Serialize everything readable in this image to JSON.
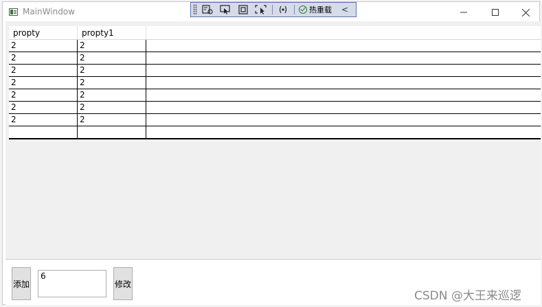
{
  "window": {
    "title": "MainWindow"
  },
  "debug_toolbar": {
    "hot_reload_label": "热重载",
    "collapse_glyph": "<"
  },
  "grid": {
    "columns": [
      "propty",
      "propty1"
    ],
    "rows": [
      [
        "2",
        "2"
      ],
      [
        "2",
        "2"
      ],
      [
        "2",
        "2"
      ],
      [
        "2",
        "2"
      ],
      [
        "2",
        "2"
      ],
      [
        "2",
        "2"
      ],
      [
        "2",
        "2"
      ],
      [
        "",
        ""
      ]
    ]
  },
  "actions": {
    "add_label": "添加",
    "edit_label": "修改",
    "input_value": "6"
  },
  "watermark": "CSDN @大王来巡逻"
}
